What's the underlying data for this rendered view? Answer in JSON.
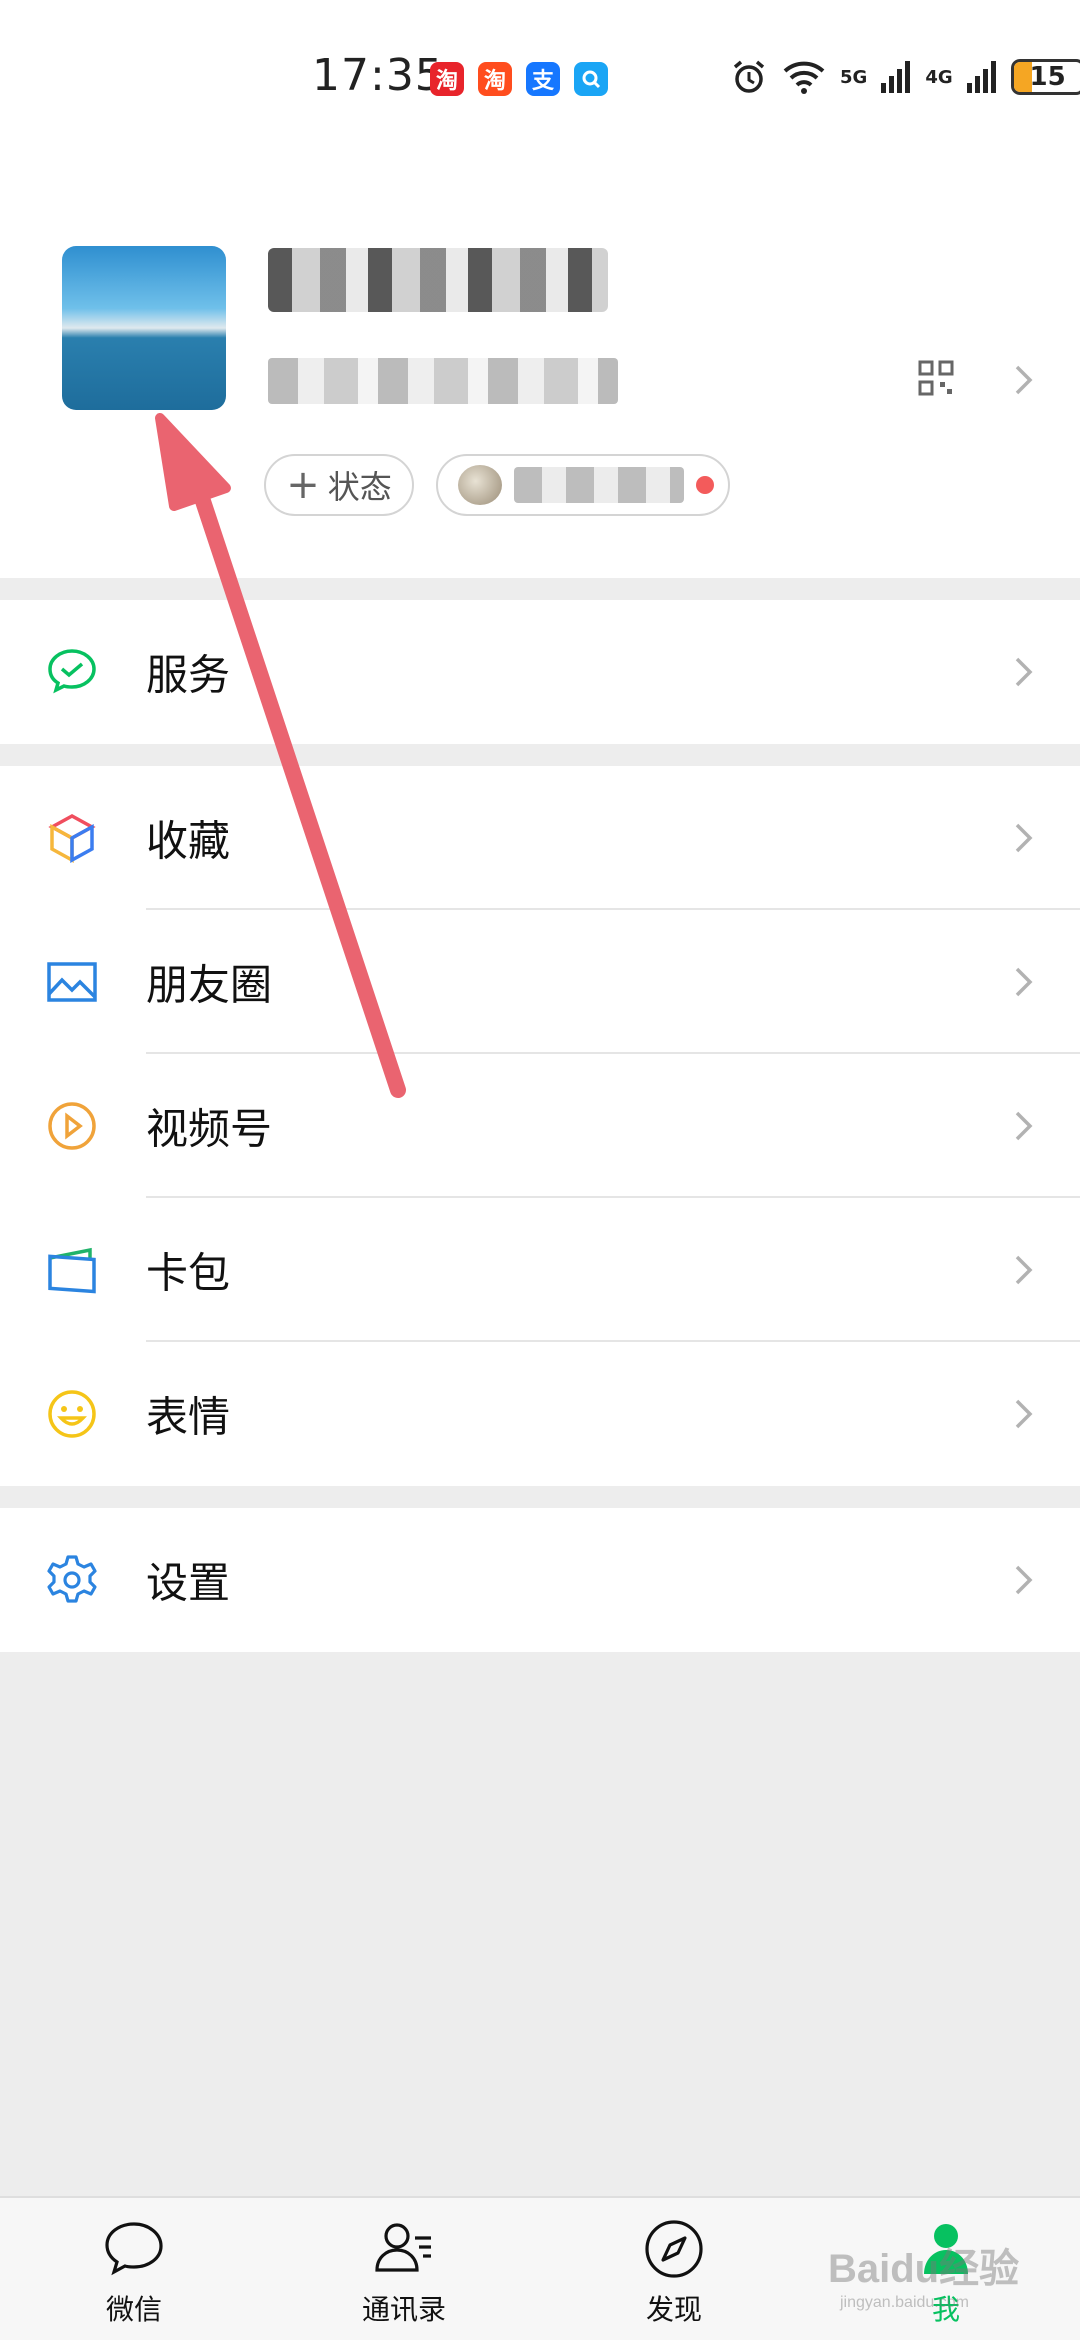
{
  "status_bar": {
    "time": "17:35",
    "net_5g": "5G",
    "net_4g": "4G",
    "battery": "15",
    "notif_icons": [
      {
        "name": "taobao-special-icon",
        "char": "淘",
        "color": "#e8242b"
      },
      {
        "name": "taobao-icon",
        "char": "淘",
        "color": "#ff4d1e"
      },
      {
        "name": "alipay-icon",
        "char": "支",
        "color": "#1677ff"
      },
      {
        "name": "search-app-icon",
        "char": "",
        "color": "#1aa5f5"
      }
    ]
  },
  "profile": {
    "status_chip": "状态"
  },
  "menu": {
    "service": "服务",
    "favorites": "收藏",
    "moments": "朋友圈",
    "channels": "视频号",
    "cards": "卡包",
    "stickers": "表情",
    "settings": "设置"
  },
  "tabbar": {
    "chats": "微信",
    "contacts": "通讯录",
    "discover": "发现",
    "me": "我"
  },
  "colors": {
    "accent_green": "#07c160",
    "annotation_arrow": "#ea6470"
  },
  "watermark": {
    "brand": "Baidu经验",
    "url": "jingyan.baidu.com"
  }
}
